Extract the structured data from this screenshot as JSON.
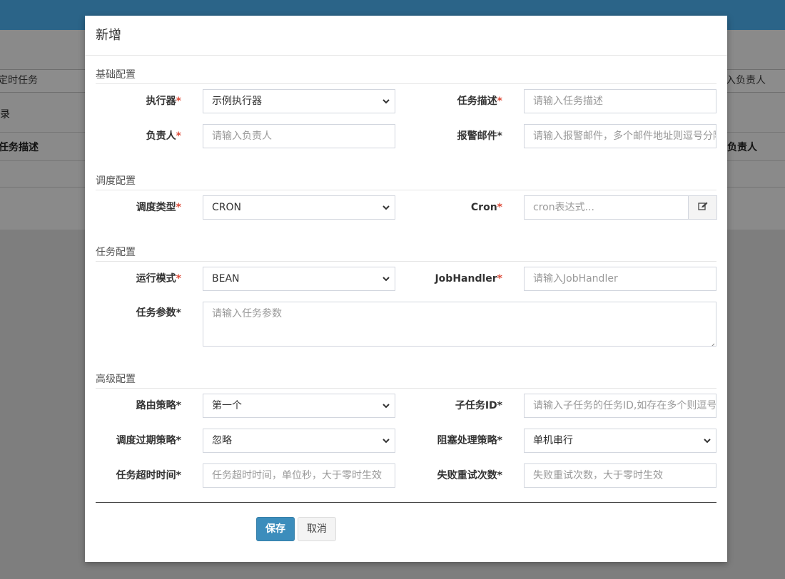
{
  "background": {
    "left_input_text": "定时任务",
    "row_text": "录",
    "col_header_left": "任务描述",
    "right_input_placeholder": "入负责人",
    "col_header_right": "负责人"
  },
  "modal": {
    "title": "新增",
    "sections": {
      "basic": "基础配置",
      "schedule": "调度配置",
      "task": "任务配置",
      "advanced": "高级配置"
    },
    "fields": {
      "executor": {
        "label": "执行器",
        "value": "示例执行器"
      },
      "job_desc": {
        "label": "任务描述",
        "placeholder": "请输入任务描述"
      },
      "author": {
        "label": "负责人",
        "placeholder": "请输入负责人"
      },
      "alarm_email": {
        "label": "报警邮件",
        "placeholder": "请输入报警邮件，多个邮件地址则逗号分隔"
      },
      "schedule_type": {
        "label": "调度类型",
        "value": "CRON"
      },
      "cron": {
        "label": "Cron",
        "placeholder": "cron表达式..."
      },
      "glue_type": {
        "label": "运行模式",
        "value": "BEAN"
      },
      "job_handler": {
        "label": "JobHandler",
        "placeholder": "请输入JobHandler"
      },
      "job_param": {
        "label": "任务参数",
        "placeholder": "请输入任务参数"
      },
      "route_strategy": {
        "label": "路由策略",
        "value": "第一个"
      },
      "child_job_id": {
        "label": "子任务ID",
        "placeholder": "请输入子任务的任务ID,如存在多个则逗号分隔"
      },
      "misfire_strategy": {
        "label": "调度过期策略",
        "value": "忽略"
      },
      "block_strategy": {
        "label": "阻塞处理策略",
        "value": "单机串行"
      },
      "timeout": {
        "label": "任务超时时间",
        "placeholder": "任务超时时间，单位秒，大于零时生效"
      },
      "fail_retry": {
        "label": "失败重试次数",
        "placeholder": "失败重试次数，大于零时生效"
      }
    },
    "required_mark": "*",
    "buttons": {
      "save": "保存",
      "cancel": "取消"
    }
  },
  "colors": {
    "topbar": "#2b6488",
    "primary": "#3c8dbc",
    "required": "#dd4b39"
  },
  "icons": {
    "select_arrow": "chevron-down-icon",
    "cron_edit": "edit-icon"
  }
}
